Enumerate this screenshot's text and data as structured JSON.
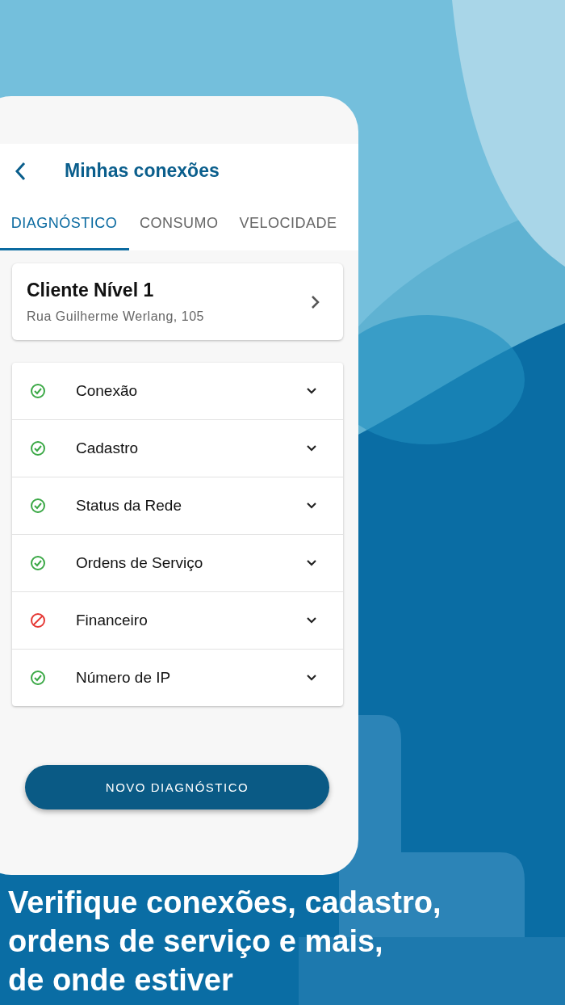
{
  "screen_title": "Minhas conexões",
  "tabs": [
    {
      "label": "DIAGNÓSTICO",
      "selected": true
    },
    {
      "label": "CONSUMO",
      "selected": false
    },
    {
      "label": "VELOCIDADE",
      "selected": false
    }
  ],
  "client": {
    "name": "Cliente Nível 1",
    "address": "Rua Guilherme Werlang, 105"
  },
  "checks": [
    {
      "label": "Conexão",
      "kind": "ok"
    },
    {
      "label": "Cadastro",
      "kind": "ok"
    },
    {
      "label": "Status da Rede",
      "kind": "ok"
    },
    {
      "label": "Ordens de Serviço",
      "kind": "ok"
    },
    {
      "label": "Financeiro",
      "kind": "blocked"
    },
    {
      "label": "Número de IP",
      "kind": "ok"
    }
  ],
  "button": "NOVO DIAGNÓSTICO",
  "caption": [
    "Verifique conexões, cadastro,",
    "ordens de serviço e mais,",
    "de onde estiver"
  ]
}
